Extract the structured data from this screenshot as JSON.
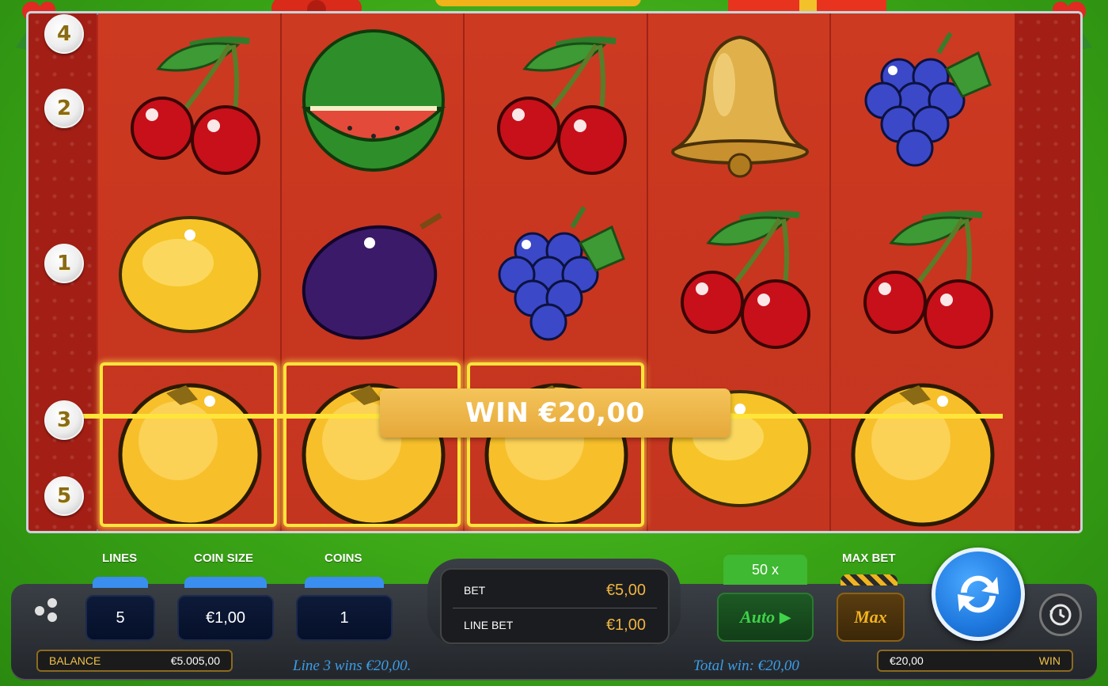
{
  "reels": [
    [
      "cherry",
      "lemon",
      "orange"
    ],
    [
      "watermelon",
      "plum",
      "orange"
    ],
    [
      "cherry",
      "grapes",
      "orange"
    ],
    [
      "bell",
      "cherry",
      "lemon"
    ],
    [
      "grapes",
      "cherry",
      "orange"
    ]
  ],
  "line_numbers_left": [
    "4",
    "2",
    "1",
    "3",
    "5"
  ],
  "win_banner": "WIN €20,00",
  "controls": {
    "lines_label": "LINES",
    "lines_value": "5",
    "coin_size_label": "COIN SIZE",
    "coin_size_value": "€1,00",
    "coins_label": "COINS",
    "coins_value": "1",
    "bet_label": "BET",
    "bet_value": "€5,00",
    "line_bet_label": "LINE BET",
    "line_bet_value": "€1,00",
    "multiplier": "50 x",
    "auto_label": "Auto",
    "max_bet_label": "MAX BET",
    "max_label": "Max",
    "balance_label": "BALANCE",
    "balance_value": "€5.005,00",
    "win_value": "€20,00",
    "win_label": "WIN"
  },
  "status": {
    "line_message": "Line 3 wins €20,00.",
    "total_message": "Total win: €20,00"
  },
  "colors": {
    "highlight": "#ffe53a",
    "reel_bg": "#c8361f",
    "spin_button": "#1e78de",
    "status_text": "#3b9de8"
  }
}
